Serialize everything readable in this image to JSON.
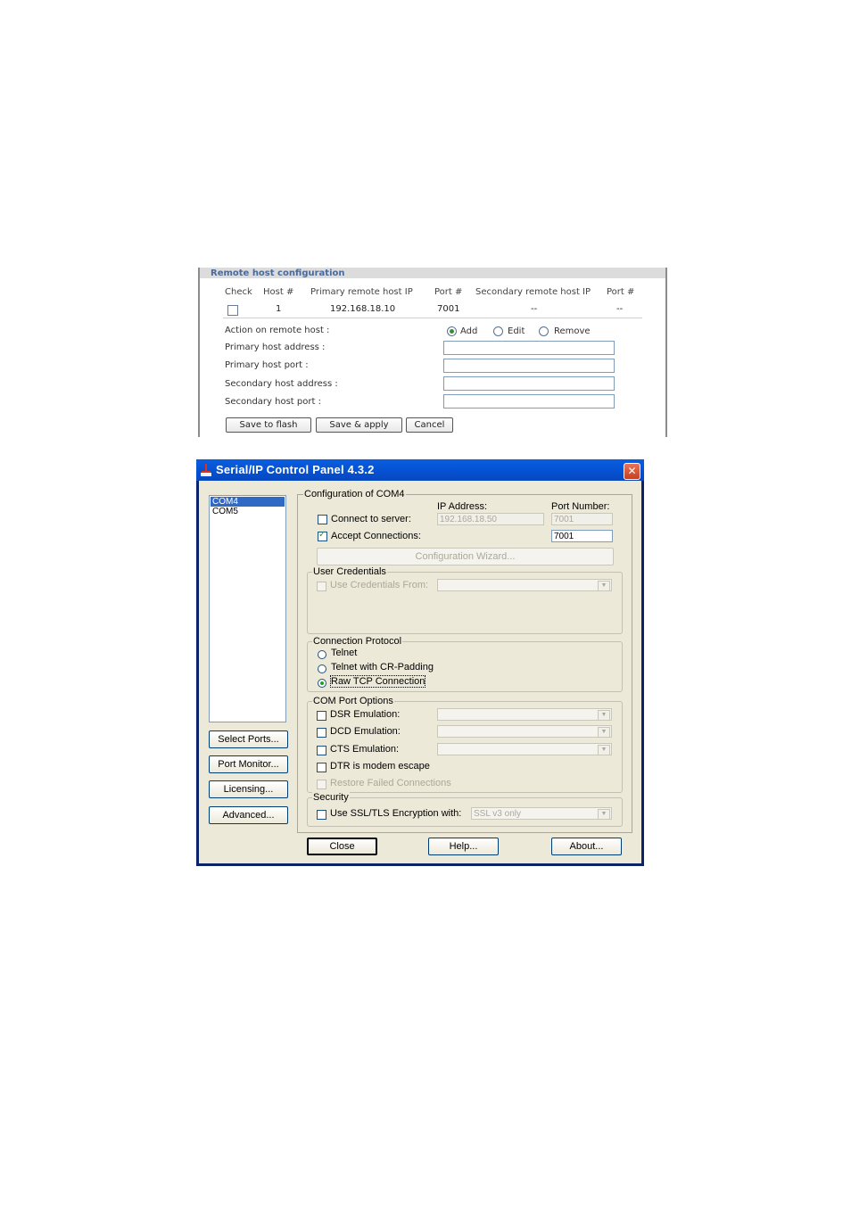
{
  "remote_host": {
    "title": "Remote host configuration",
    "columns": [
      "Check",
      "Host #",
      "Primary remote host IP",
      "Port #",
      "Secondary remote host IP",
      "Port #"
    ],
    "row": {
      "host": "1",
      "primary_ip": "192.168.18.10",
      "port": "7001",
      "secondary_ip": "--",
      "secondary_port": "--"
    },
    "action_label": "Action on remote host :",
    "actions": [
      "Add",
      "Edit",
      "Remove"
    ],
    "action_selected": "Add",
    "fields": {
      "primary_address": "Primary host address :",
      "primary_port": "Primary host port :",
      "secondary_address": "Secondary host address :",
      "secondary_port": "Secondary host port :"
    },
    "buttons": {
      "save_flash": "Save to flash",
      "save_apply": "Save & apply",
      "cancel": "Cancel"
    }
  },
  "serial_ip": {
    "title": "Serial/IP Control Panel 4.3.2",
    "close_glyph": "✕",
    "ports": [
      "COM4",
      "COM5"
    ],
    "selected_port": "COM4",
    "side_buttons": {
      "select_ports": "Select Ports...",
      "port_monitor": "Port Monitor...",
      "licensing": "Licensing...",
      "advanced": "Advanced..."
    },
    "config": {
      "group_title": "Configuration of COM4",
      "ip_address_label": "IP Address:",
      "port_number_label": "Port Number:",
      "connect_to_server": "Connect to server:",
      "connect_ip": "192.168.18.50",
      "connect_port": "7001",
      "accept_connections": "Accept Connections:",
      "accept_port": "7001",
      "wizard_button": "Configuration Wizard..."
    },
    "credentials": {
      "group_title": "User Credentials",
      "use_from": "Use Credentials From:"
    },
    "protocol": {
      "group_title": "Connection Protocol",
      "options": [
        "Telnet",
        "Telnet with CR-Padding",
        "Raw TCP Connection"
      ],
      "selected": "Raw TCP Connection"
    },
    "com_options": {
      "group_title": "COM Port Options",
      "dsr": "DSR Emulation:",
      "dcd": "DCD Emulation:",
      "cts": "CTS Emulation:",
      "dtr": "DTR is modem escape",
      "restore": "Restore Failed Connections"
    },
    "security": {
      "group_title": "Security",
      "ssl_label": "Use SSL/TLS Encryption with:",
      "ssl_value": "SSL v3 only"
    },
    "bottom_buttons": {
      "close": "Close",
      "help": "Help...",
      "about": "About..."
    }
  }
}
